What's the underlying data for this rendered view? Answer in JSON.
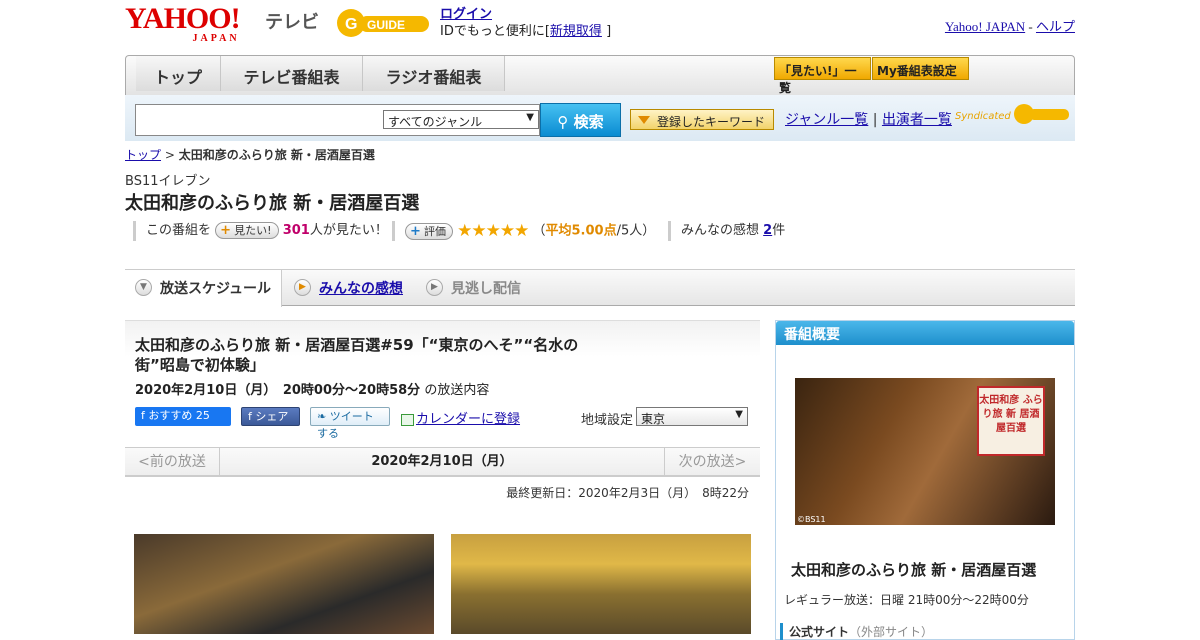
{
  "header": {
    "yahoo_logo": "YAHOO!",
    "japan_logo": "JAPAN",
    "tv_logo": "テレビ",
    "gguide_logo": "G GUIDE",
    "login": "ログイン",
    "login_prompt_pre": "IDでもっと便利に[",
    "signup": "新規取得",
    "login_prompt_post": "]",
    "yahoo_japan_link": "Yahoo! JAPAN",
    "separator": " - ",
    "help_link": "ヘルプ"
  },
  "nav": {
    "tabs": [
      {
        "label": "トップ"
      },
      {
        "label": "テレビ番組表"
      },
      {
        "label": "ラジオ番組表"
      }
    ],
    "mitai_list": "「見たい!」一覧",
    "my_schedule": "My番組表設定"
  },
  "search": {
    "placeholder": "",
    "genre_selected": "すべてのジャンル",
    "search_button": "検索",
    "keyword_button": "登録したキーワード",
    "genre_list": "ジャンル一覧",
    "divider": "|",
    "performer_list": "出演者一覧",
    "syndicated": "Syndicated"
  },
  "breadcrumb": {
    "top": "トップ",
    "sep": " > ",
    "current": "太田和彦のふらり旅 新・居酒屋百選"
  },
  "program": {
    "channel": "BS11イレブン",
    "title": "太田和彦のふらり旅 新・居酒屋百選",
    "want_pre": "この番組を",
    "want_pill": "見たい!",
    "want_count": "301",
    "want_post": "人が見たい！",
    "rating_pill": "評価",
    "stars": "★★★★★",
    "avg_open": "（",
    "avg": "平均5.00点",
    "avg_count": "/5人）",
    "impressions_pre": "みんなの感想",
    "impressions_count": "2",
    "impressions_post": "件"
  },
  "tabs": [
    {
      "label": "放送スケジュール",
      "icon": "▼"
    },
    {
      "label": "みんなの感想",
      "icon": "▶"
    },
    {
      "label": "見逃し配信",
      "icon": "▶"
    }
  ],
  "episode": {
    "title": "太田和彦のふらり旅 新・居酒屋百選#59「“東京のへそ”“名水の街”昭島で初体験」",
    "date_time": "2020年2月10日（月）　20時00分～20時58分",
    "suffix": "の放送内容",
    "fb_recommend": "おすすめ 25",
    "fb_share": "シェア",
    "tweet": "ツイートする",
    "calendar": "カレンダーに登録",
    "region_label": "地域設定",
    "region": "東京"
  },
  "day_nav": {
    "prev": "<前の放送",
    "date": "2020年2月10日（月）",
    "next": "次の放送>"
  },
  "last_updated": "最終更新日：2020年2月3日（月）　8時22分",
  "sidebar": {
    "header": "番組概要",
    "seal_text": "太田和彦 ふらり旅 新 居酒屋百選",
    "copyright": "©BS11",
    "title": "太田和彦のふらり旅 新・居酒屋百選",
    "regular": "レギュラー放送：日曜 21時00分～22時00分",
    "official_site": "公式サイト",
    "external": "（外部サイト）"
  }
}
